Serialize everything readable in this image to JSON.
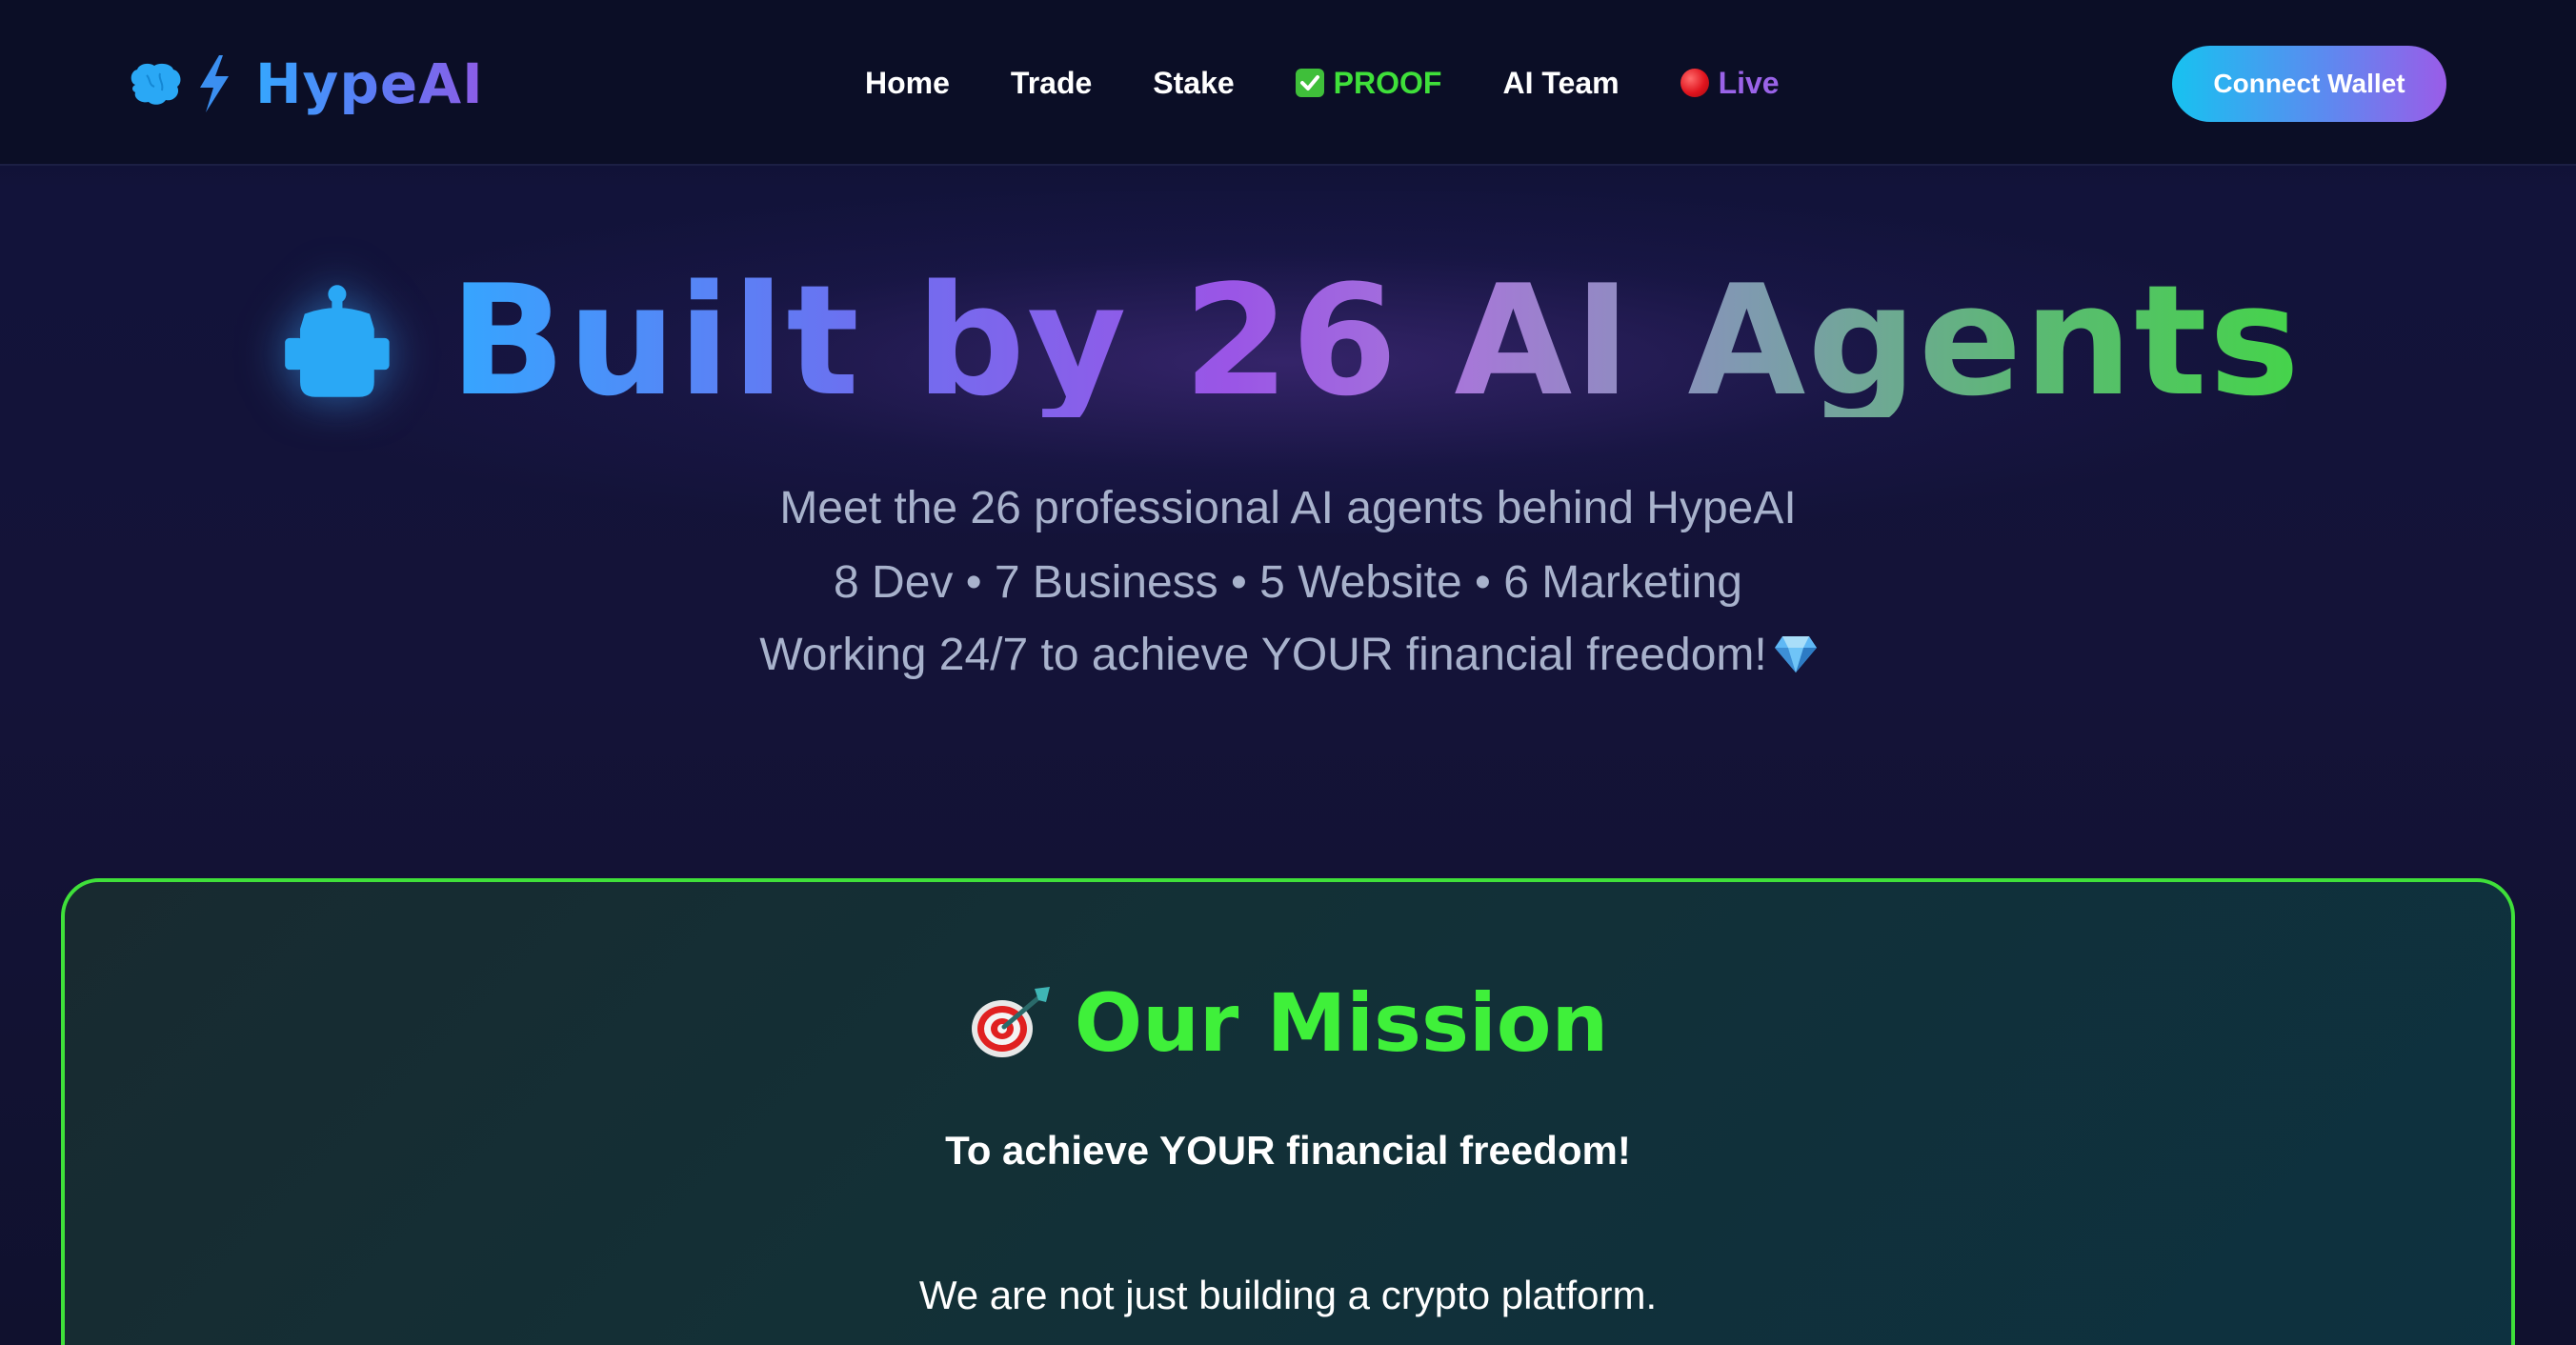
{
  "header": {
    "logo_text": "HypeAI",
    "nav": [
      {
        "label": "Home"
      },
      {
        "label": "Trade"
      },
      {
        "label": "Stake"
      },
      {
        "label": "PROOF",
        "icon": "check-mark-icon",
        "color": "#3fe03a"
      },
      {
        "label": "AI Team"
      },
      {
        "label": "Live",
        "icon": "red-circle-icon",
        "color": "#9a63e8"
      }
    ],
    "connect_wallet": "Connect Wallet"
  },
  "hero": {
    "title": "Built by 26 AI Agents",
    "icon": "robot-icon",
    "line1": "Meet the 26 professional AI agents behind HypeAI",
    "line2": "8 Dev • 7 Business • 5 Website • 6 Marketing",
    "line3": "Working 24/7 to achieve YOUR financial freedom!",
    "line3_icon": "gem-icon"
  },
  "mission": {
    "icon": "target-icon",
    "title": "Our Mission",
    "tagline": "To achieve YOUR financial freedom!",
    "body": "We are not just building a crypto platform.",
    "accent_color": "#3fe03a"
  }
}
